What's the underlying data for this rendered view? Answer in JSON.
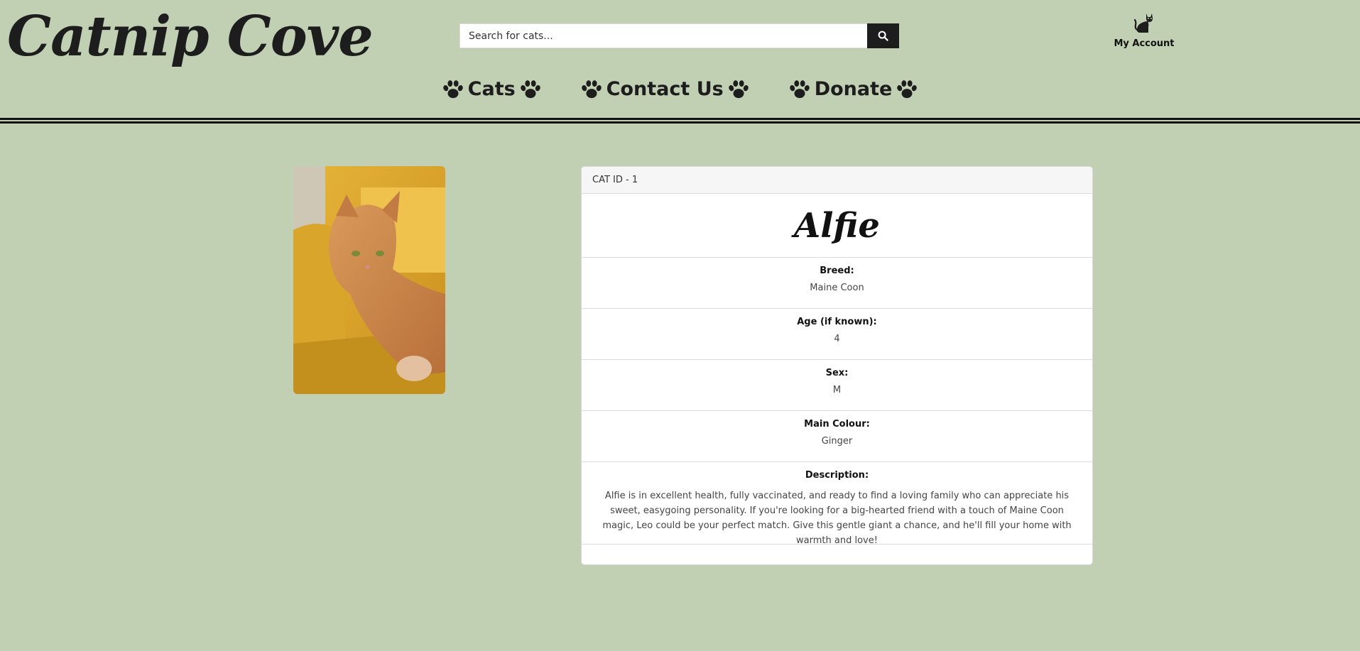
{
  "header": {
    "logo_text": "Catnip Cove",
    "search_placeholder": "Search for cats...",
    "account_label": "My Account"
  },
  "nav": {
    "items": [
      {
        "label": "Cats"
      },
      {
        "label": "Contact Us"
      },
      {
        "label": "Donate"
      }
    ]
  },
  "cat": {
    "id_label": "CAT ID - 1",
    "name": "Alfie",
    "photo_alt": "Alfie",
    "fields": [
      {
        "label": "Breed:",
        "value": "Maine Coon"
      },
      {
        "label": "Age (if known):",
        "value": "4"
      },
      {
        "label": "Sex:",
        "value": "M"
      },
      {
        "label": "Main Colour:",
        "value": "Ginger"
      }
    ],
    "description_label": "Description:",
    "description": "Alfie is in excellent health, fully vaccinated, and ready to find a loving family who can appreciate his sweet, easygoing personality. If you're looking for a big-hearted friend with a touch of Maine Coon magic, Leo could be your perfect match. Give this gentle giant a chance, and he'll fill your home with warmth and love!"
  },
  "icons": {
    "search": "search-icon",
    "account": "cat-icon",
    "nav_decoration": "paw-icon"
  },
  "colors": {
    "background": "#c1cfb2",
    "dark": "#1d1d1d",
    "card": "#ffffff"
  }
}
